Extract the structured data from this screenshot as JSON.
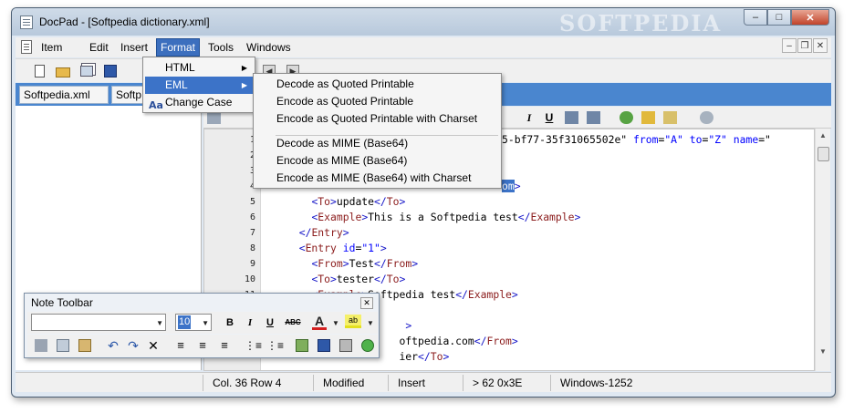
{
  "window": {
    "title": "DocPad - [Softpedia dictionary.xml]",
    "watermark": "SOFTPEDIA",
    "minimize": "–",
    "maximize": "□",
    "close": "✕"
  },
  "menubar": {
    "items": [
      "Item",
      "Edit",
      "Insert",
      "Format",
      "Tools",
      "Windows"
    ],
    "active": "Format",
    "mdi_minimize": "–",
    "mdi_restore": "❐",
    "mdi_close": "✕"
  },
  "tabs": [
    {
      "label": "Softpedia.xml",
      "close": "✕"
    },
    {
      "label": "Softp"
    }
  ],
  "format_menu": {
    "items": [
      {
        "label": "HTML",
        "arrow": "▶"
      },
      {
        "label": "EML",
        "arrow": "▶"
      },
      {
        "label": "Change Case",
        "icon": "Aa"
      }
    ],
    "highlighted": "EML"
  },
  "eml_submenu": {
    "items": [
      "Decode as Quoted Printable",
      "Encode as Quoted Printable",
      "Encode as Quoted Printable with Charset",
      "Decode as MIME (Base64)",
      "Encode as MIME (Base64)",
      "Encode as MIME (Base64) with Charset"
    ]
  },
  "editor_toolbar": {
    "italic": "I",
    "underline": "U"
  },
  "editor": {
    "lines": [
      {
        "n": "1",
        "parts": [
          [
            "txt",
            "5-bf77-35f31065502e\" "
          ],
          [
            "attr",
            "from"
          ],
          [
            "txt",
            "="
          ],
          [
            "val",
            "\"A\" "
          ],
          [
            "attr",
            "to"
          ],
          [
            "txt",
            "="
          ],
          [
            "val",
            "\"Z\" "
          ],
          [
            "attr",
            "name"
          ],
          [
            "txt",
            "=\""
          ]
        ]
      },
      {
        "n": "2",
        "parts": []
      },
      {
        "n": "3",
        "parts": []
      },
      {
        "n": "4",
        "parts": [
          [
            "sel",
            "om"
          ],
          [
            "br",
            ">"
          ]
        ]
      },
      {
        "n": "5",
        "parts": [
          [
            "txt",
            "    "
          ],
          [
            "br",
            "<"
          ],
          [
            "tag",
            "To"
          ],
          [
            "br",
            ">"
          ],
          [
            "txt",
            "update"
          ],
          [
            "br",
            "</"
          ],
          [
            "tag",
            "To"
          ],
          [
            "br",
            ">"
          ]
        ]
      },
      {
        "n": "6",
        "parts": [
          [
            "txt",
            "    "
          ],
          [
            "br",
            "<"
          ],
          [
            "tag",
            "Example"
          ],
          [
            "br",
            ">"
          ],
          [
            "txt",
            "This is a Softpedia test"
          ],
          [
            "br",
            "</"
          ],
          [
            "tag",
            "Example"
          ],
          [
            "br",
            ">"
          ]
        ]
      },
      {
        "n": "7",
        "parts": [
          [
            "txt",
            "  "
          ],
          [
            "br",
            "</"
          ],
          [
            "tag",
            "Entry"
          ],
          [
            "br",
            ">"
          ]
        ]
      },
      {
        "n": "8",
        "parts": [
          [
            "txt",
            "  "
          ],
          [
            "br",
            "<"
          ],
          [
            "tag",
            "Entry "
          ],
          [
            "attr",
            "id"
          ],
          [
            "txt",
            "="
          ],
          [
            "val",
            "\"1\""
          ],
          [
            "br",
            ">"
          ]
        ]
      },
      {
        "n": "9",
        "parts": [
          [
            "txt",
            "    "
          ],
          [
            "br",
            "<"
          ],
          [
            "tag",
            "From"
          ],
          [
            "br",
            ">"
          ],
          [
            "txt",
            "Test"
          ],
          [
            "br",
            "</"
          ],
          [
            "tag",
            "From"
          ],
          [
            "br",
            ">"
          ]
        ]
      },
      {
        "n": "10",
        "parts": [
          [
            "txt",
            "    "
          ],
          [
            "br",
            "<"
          ],
          [
            "tag",
            "To"
          ],
          [
            "br",
            ">"
          ],
          [
            "txt",
            "tester"
          ],
          [
            "br",
            "</"
          ],
          [
            "tag",
            "To"
          ],
          [
            "br",
            ">"
          ]
        ]
      },
      {
        "n": "11",
        "parts": [
          [
            "txt",
            "    "
          ],
          [
            "br",
            "<"
          ],
          [
            "tag",
            "Example"
          ],
          [
            "br",
            ">"
          ],
          [
            "txt",
            "Softpedia test"
          ],
          [
            "br",
            "</"
          ],
          [
            "tag",
            "Example"
          ],
          [
            "br",
            ">"
          ]
        ]
      },
      {
        "n": "",
        "parts": []
      },
      {
        "n": "",
        "parts": [
          [
            "txt",
            "                   "
          ],
          [
            "br",
            ">"
          ]
        ]
      },
      {
        "n": "",
        "parts": [
          [
            "txt",
            "                  "
          ],
          [
            "txt",
            "oftpedia.com"
          ],
          [
            "br",
            "</"
          ],
          [
            "tag",
            "From"
          ],
          [
            "br",
            ">"
          ]
        ]
      },
      {
        "n": "",
        "parts": [
          [
            "txt",
            "                  "
          ],
          [
            "txt",
            "ier"
          ],
          [
            "br",
            "</"
          ],
          [
            "tag",
            "To"
          ],
          [
            "br",
            ">"
          ]
        ]
      }
    ]
  },
  "note_toolbar": {
    "title": "Note Toolbar",
    "close": "✕",
    "font_size": "10",
    "bold": "B",
    "italic": "I",
    "underline": "U",
    "strike": "ABC",
    "font_color": "A",
    "highlight": "ab"
  },
  "status": {
    "position": "Col. 36  Row 4",
    "modified": "Modified",
    "mode": "Insert",
    "char": ">  62  0x3E",
    "encoding": "Windows-1252"
  },
  "colors": {
    "accent": "#3c73c8",
    "tab_bar": "#4a86cf",
    "tag": "#8b1c1c",
    "attr": "#0000ff"
  }
}
